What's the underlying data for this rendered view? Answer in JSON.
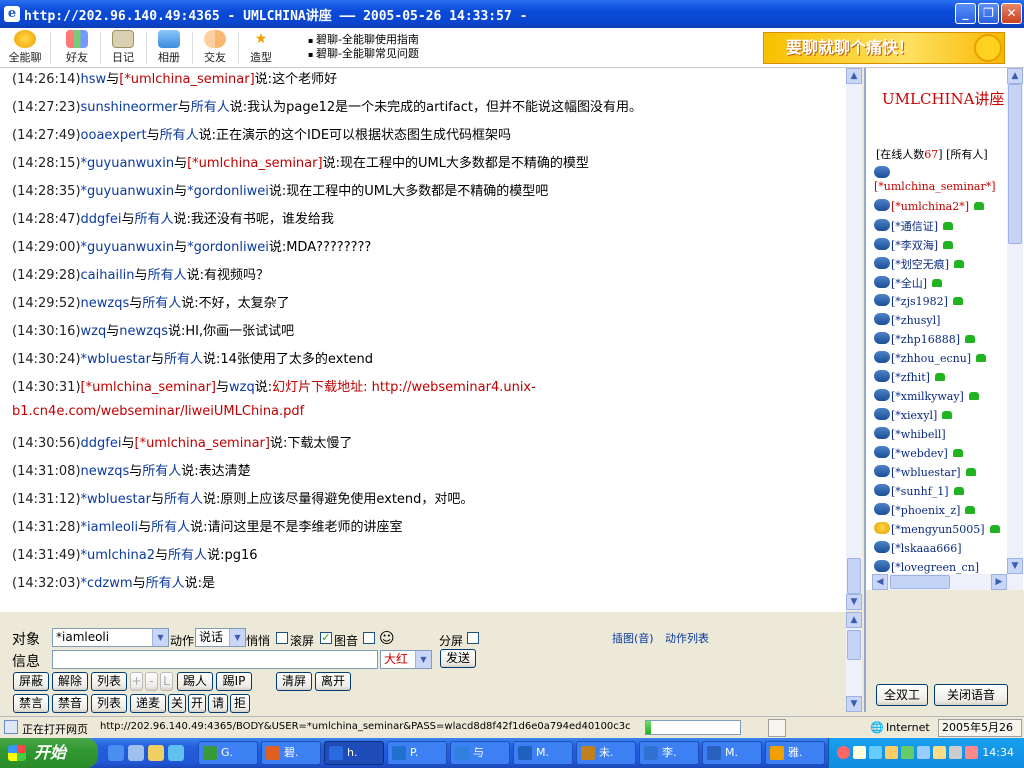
{
  "window": {
    "title": "http://202.96.140.49:4365 - UMLCHINA讲座 —— 2005-05-26 14:33:57 -",
    "min": "_",
    "max": "❐",
    "close": "✕"
  },
  "toolbar": {
    "items": [
      {
        "label": "全能聊"
      },
      {
        "label": "好友"
      },
      {
        "label": "日记"
      },
      {
        "label": "相册"
      },
      {
        "label": "交友"
      },
      {
        "label": "造型"
      }
    ],
    "links": [
      "碧聊-全能聊使用指南",
      "碧聊-全能聊常见问题"
    ],
    "banner": "要聊就聊个痛快！"
  },
  "chat": {
    "messages": [
      {
        "time": "(14:26:14)",
        "user": "hsw",
        "conn": "与",
        "to": "[*umlchina_seminar]",
        "to_red": true,
        "said": "说:",
        "text": "这个老师好"
      },
      {
        "time": "(14:27:23)",
        "user": "sunshineormer",
        "conn": "与",
        "to": "所有人",
        "said": "说:",
        "text": "我认为page12是一个未完成的artifact，但并不能说这幅图没有用。"
      },
      {
        "time": "(14:27:49)",
        "user": "ooaexpert",
        "conn": "与",
        "to": "所有人",
        "said": "说:",
        "text": "正在演示的这个IDE可以根据状态图生成代码框架吗"
      },
      {
        "time": "(14:28:15)",
        "user": "*guyuanwuxin",
        "conn": "与",
        "to": "[*umlchina_seminar]",
        "to_red": true,
        "said": "说:",
        "text": "现在工程中的UML大多数都是不精确的模型"
      },
      {
        "time": "(14:28:35)",
        "user": "*guyuanwuxin",
        "conn": "与",
        "to": "*gordonliwei",
        "said": "说:",
        "text": "现在工程中的UML大多数都是不精确的模型吧"
      },
      {
        "time": "(14:28:47)",
        "user": "ddgfei",
        "conn": "与",
        "to": "所有人",
        "said": "说:",
        "text": "我还没有书呢，谁发给我"
      },
      {
        "time": "(14:29:00)",
        "user": "*guyuanwuxin",
        "conn": "与",
        "to": "*gordonliwei",
        "said": "说:",
        "text": "MDA????????"
      },
      {
        "time": "(14:29:28)",
        "user": "caihailin",
        "conn": "与",
        "to": "所有人",
        "said": "说:",
        "text": "有视频吗？"
      },
      {
        "time": "(14:29:52)",
        "user": "newzqs",
        "conn": "与",
        "to": "所有人",
        "said": "说:",
        "text": "不好，太复杂了"
      },
      {
        "time": "(14:30:16)",
        "user": "wzq",
        "conn": "与",
        "to": "newzqs",
        "said": "说:",
        "text": "HI,你画一张试试吧"
      },
      {
        "time": "(14:30:24)",
        "user": "*wbluestar",
        "conn": "与",
        "to": "所有人",
        "said": "说:",
        "text": "14张使用了太多的extend"
      },
      {
        "time": "(14:30:31)",
        "user": "[*umlchina_seminar]",
        "user_red": true,
        "conn": "与",
        "to": "wzq",
        "said": "说:",
        "text": "幻灯片下载地址: http://webseminar4.unix-",
        "text_red": true
      },
      {
        "time": "",
        "user": "",
        "conn": "",
        "to": "",
        "said": "",
        "text": "b1.cn4e.com/webseminar/liweiUMLChina.pdf",
        "text_red": true
      },
      {
        "time": "(14:30:56)",
        "user": "ddgfei",
        "conn": "与",
        "to": "[*umlchina_seminar]",
        "to_red": true,
        "said": "说:",
        "text": "下载太慢了"
      },
      {
        "time": "(14:31:08)",
        "user": "newzqs",
        "conn": "与",
        "to": "所有人",
        "said": "说:",
        "text": "表达清楚"
      },
      {
        "time": "(14:31:12)",
        "user": "*wbluestar",
        "conn": "与",
        "to": "所有人",
        "said": "说:",
        "text": "原则上应该尽量得避免使用extend，对吧。"
      },
      {
        "time": "(14:31:28)",
        "user": "*iamleoli",
        "conn": "与",
        "to": "所有人",
        "said": "说:",
        "text": "请问这里是不是李维老师的讲座室"
      },
      {
        "time": "(14:31:49)",
        "user": "*umlchina2",
        "conn": "与",
        "to": "所有人",
        "said": "说:",
        "text": "pg16"
      },
      {
        "time": "(14:32:03)",
        "user": "*cdzwm",
        "conn": "与",
        "to": "所有人",
        "said": "说:",
        "text": "是"
      }
    ]
  },
  "panel": {
    "title": "UMLCHINA讲座",
    "online_prefix": "[在线人数",
    "online_count": "67",
    "online_suffix": "]",
    "all": "[所有人]",
    "users": [
      {
        "name": "[*umlchina_seminar*]",
        "red": true,
        "avatar": "blue",
        "phone": false,
        "solo_avatar": true
      },
      {
        "name": "[*umlchina2*]",
        "red": true,
        "avatar": "blue",
        "phone": true
      },
      {
        "name": "[*通信证]",
        "avatar": "blue",
        "phone": true
      },
      {
        "name": "[*李双海]",
        "avatar": "blue",
        "phone": true
      },
      {
        "name": "[*划空无痕]",
        "avatar": "blue",
        "phone": true
      },
      {
        "name": "[*全山]",
        "avatar": "blue",
        "phone": true
      },
      {
        "name": "[*zjs1982]",
        "avatar": "blue",
        "phone": true
      },
      {
        "name": "[*zhusyl]",
        "avatar": "blue",
        "phone": false
      },
      {
        "name": "[*zhp16888]",
        "avatar": "blue",
        "phone": true
      },
      {
        "name": "[*zhhou_ecnu]",
        "avatar": "blue",
        "phone": true
      },
      {
        "name": "[*zfhit]",
        "avatar": "blue",
        "phone": true
      },
      {
        "name": "[*xmilkyway]",
        "avatar": "blue",
        "phone": true
      },
      {
        "name": "[*xiexyl]",
        "avatar": "blue",
        "phone": true
      },
      {
        "name": "[*whibell]",
        "avatar": "blue",
        "phone": false
      },
      {
        "name": "[*webdev]",
        "avatar": "blue",
        "phone": true
      },
      {
        "name": "[*wbluestar]",
        "avatar": "blue",
        "phone": true
      },
      {
        "name": "[*sunhf_1]",
        "avatar": "blue",
        "phone": true
      },
      {
        "name": "[*phoenix_z]",
        "avatar": "blue",
        "phone": true
      },
      {
        "name": "[*mengyun5005]",
        "avatar": "smiley",
        "phone": true
      },
      {
        "name": "[*lskaaa666]",
        "avatar": "blue",
        "phone": false
      },
      {
        "name": "[*lovegreen_cn]",
        "avatar": "blue",
        "phone": false
      }
    ],
    "btn_fullduplex": "全双工",
    "btn_close_voice": "关闭语音"
  },
  "controls": {
    "target_label": "对象",
    "target_value": "*iamleoli",
    "action_label": "动作",
    "action_value": "说话",
    "whisper_label": "悄悄",
    "scroll_label": "滚屏",
    "imgsound_label": "图音",
    "split_label": "分屏",
    "insert_link": "插图(音)",
    "action_list_link": "动作列表",
    "msg_label": "信息",
    "color_value": "大红",
    "send": "发送",
    "row1": [
      "屏蔽",
      "解除",
      "列表",
      "+",
      "-",
      "L",
      "踢人",
      "踢IP",
      "清屏",
      "离开"
    ],
    "row2": [
      "禁言",
      "禁音",
      "列表",
      "递麦",
      "关",
      "开",
      "请",
      "拒"
    ]
  },
  "status": {
    "state": "正在打开网页",
    "url": "http://202.96.140.49:4365/BODY&USER=*umlchina_seminar&PASS=wlacd8d8f42f1d6e0a794ed40100c3c",
    "zone": "Internet",
    "date": "2005年5月26日",
    "progress": 0.05
  },
  "taskbar": {
    "start": "开始",
    "tasks": [
      "G.",
      "碧.",
      "h.",
      "P.",
      "与",
      "M.",
      "未.",
      "李.",
      "M.",
      "雅."
    ],
    "clock": "14:34"
  }
}
